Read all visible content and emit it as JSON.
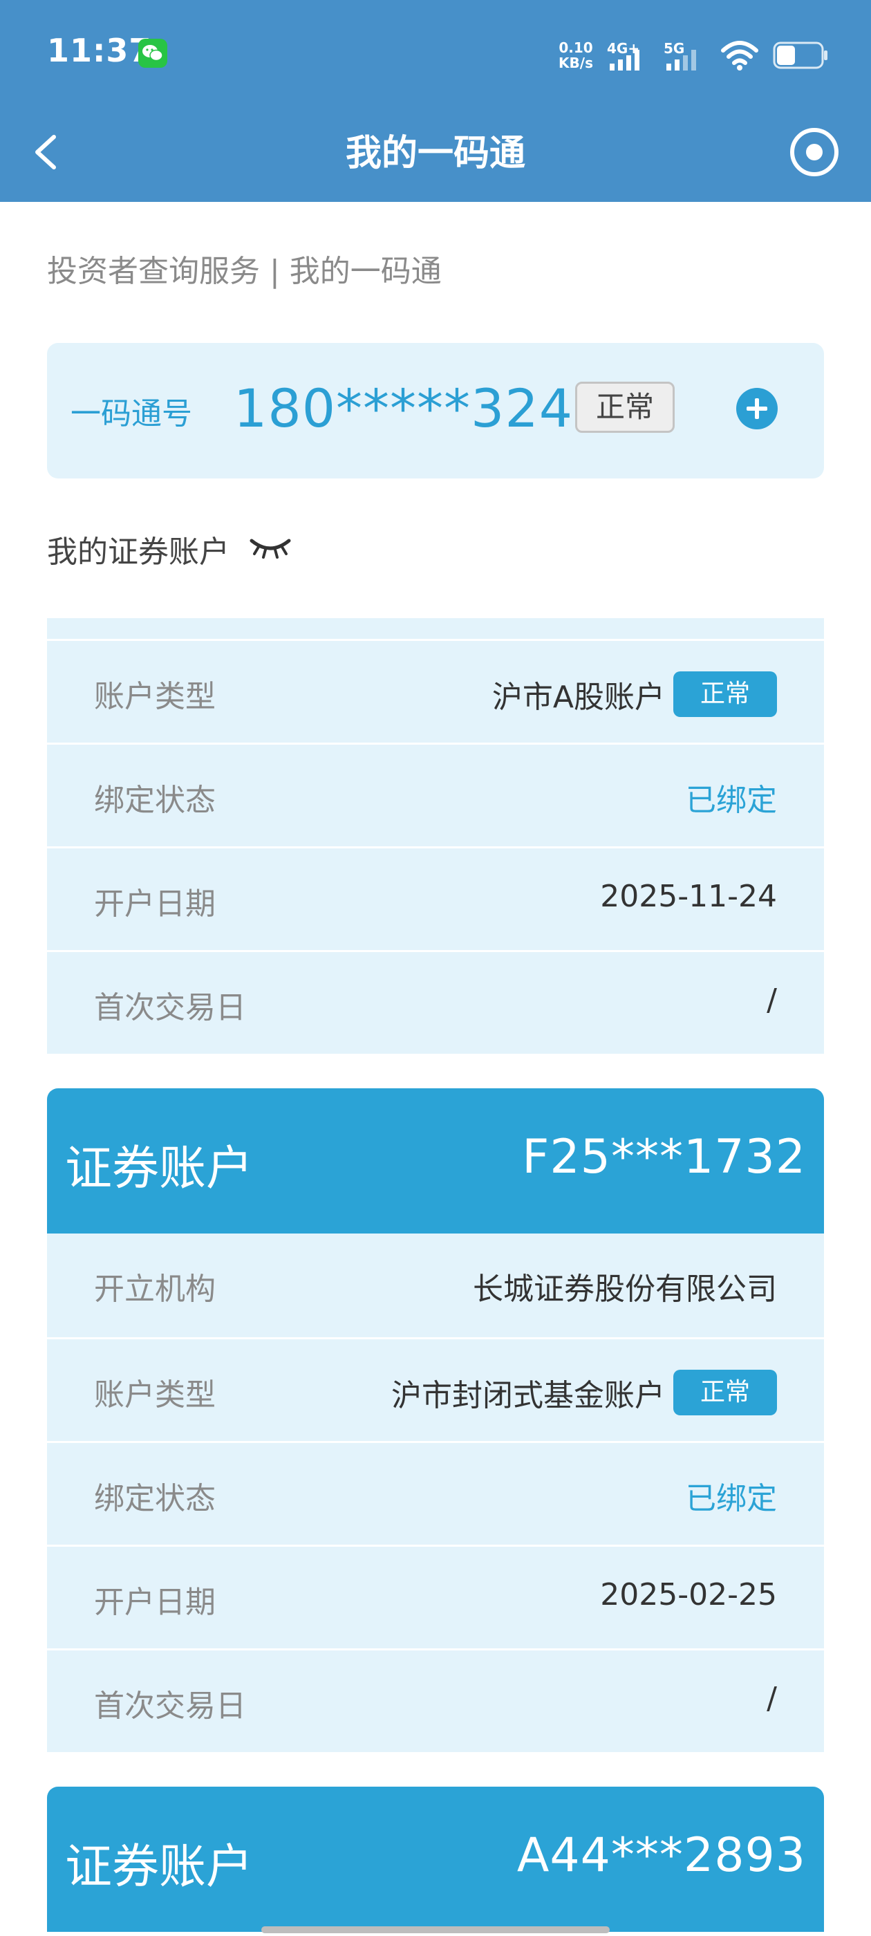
{
  "status_bar": {
    "time": "11:37",
    "app_icon": "wechat-icon",
    "net_speed_value": "0.10",
    "net_speed_unit": "KB/s",
    "signal_1": "4G+",
    "signal_2": "5G",
    "icons": [
      "wifi-icon",
      "battery-icon"
    ]
  },
  "nav": {
    "title": "我的一码通",
    "back_icon": "chevron-left-icon",
    "menu_icon": "target-icon"
  },
  "breadcrumb": "投资者查询服务 | 我的一码通",
  "ymt": {
    "label": "一码通号",
    "number": "180*****3244",
    "status": "正常",
    "add_icon": "plus-circle-icon"
  },
  "section": {
    "title": "我的证券账户",
    "toggle_icon": "closed-eye-icon"
  },
  "first_account_partial": {
    "rows": [
      {
        "label": "账户类型",
        "value": "沪市A股账户",
        "tag": "正常"
      },
      {
        "label": "绑定状态",
        "value": "已绑定"
      },
      {
        "label": "开户日期",
        "value": "2025-11-24"
      },
      {
        "label": "首次交易日",
        "value": "/"
      }
    ]
  },
  "accounts": [
    {
      "header_label": "证券账户",
      "account_no": "F25***1732",
      "rows": [
        {
          "label": "开立机构",
          "value": "长城证券股份有限公司"
        },
        {
          "label": "账户类型",
          "value": "沪市封闭式基金账户",
          "tag": "正常"
        },
        {
          "label": "绑定状态",
          "value": "已绑定"
        },
        {
          "label": "开户日期",
          "value": "2025-02-25"
        },
        {
          "label": "首次交易日",
          "value": "/"
        }
      ]
    },
    {
      "header_label": "证券账户",
      "account_no": "A44***2893"
    }
  ],
  "colors": {
    "header_bg": "#4790c9",
    "accent": "#2ba3d6",
    "row_bg": "#e3f3fb"
  }
}
